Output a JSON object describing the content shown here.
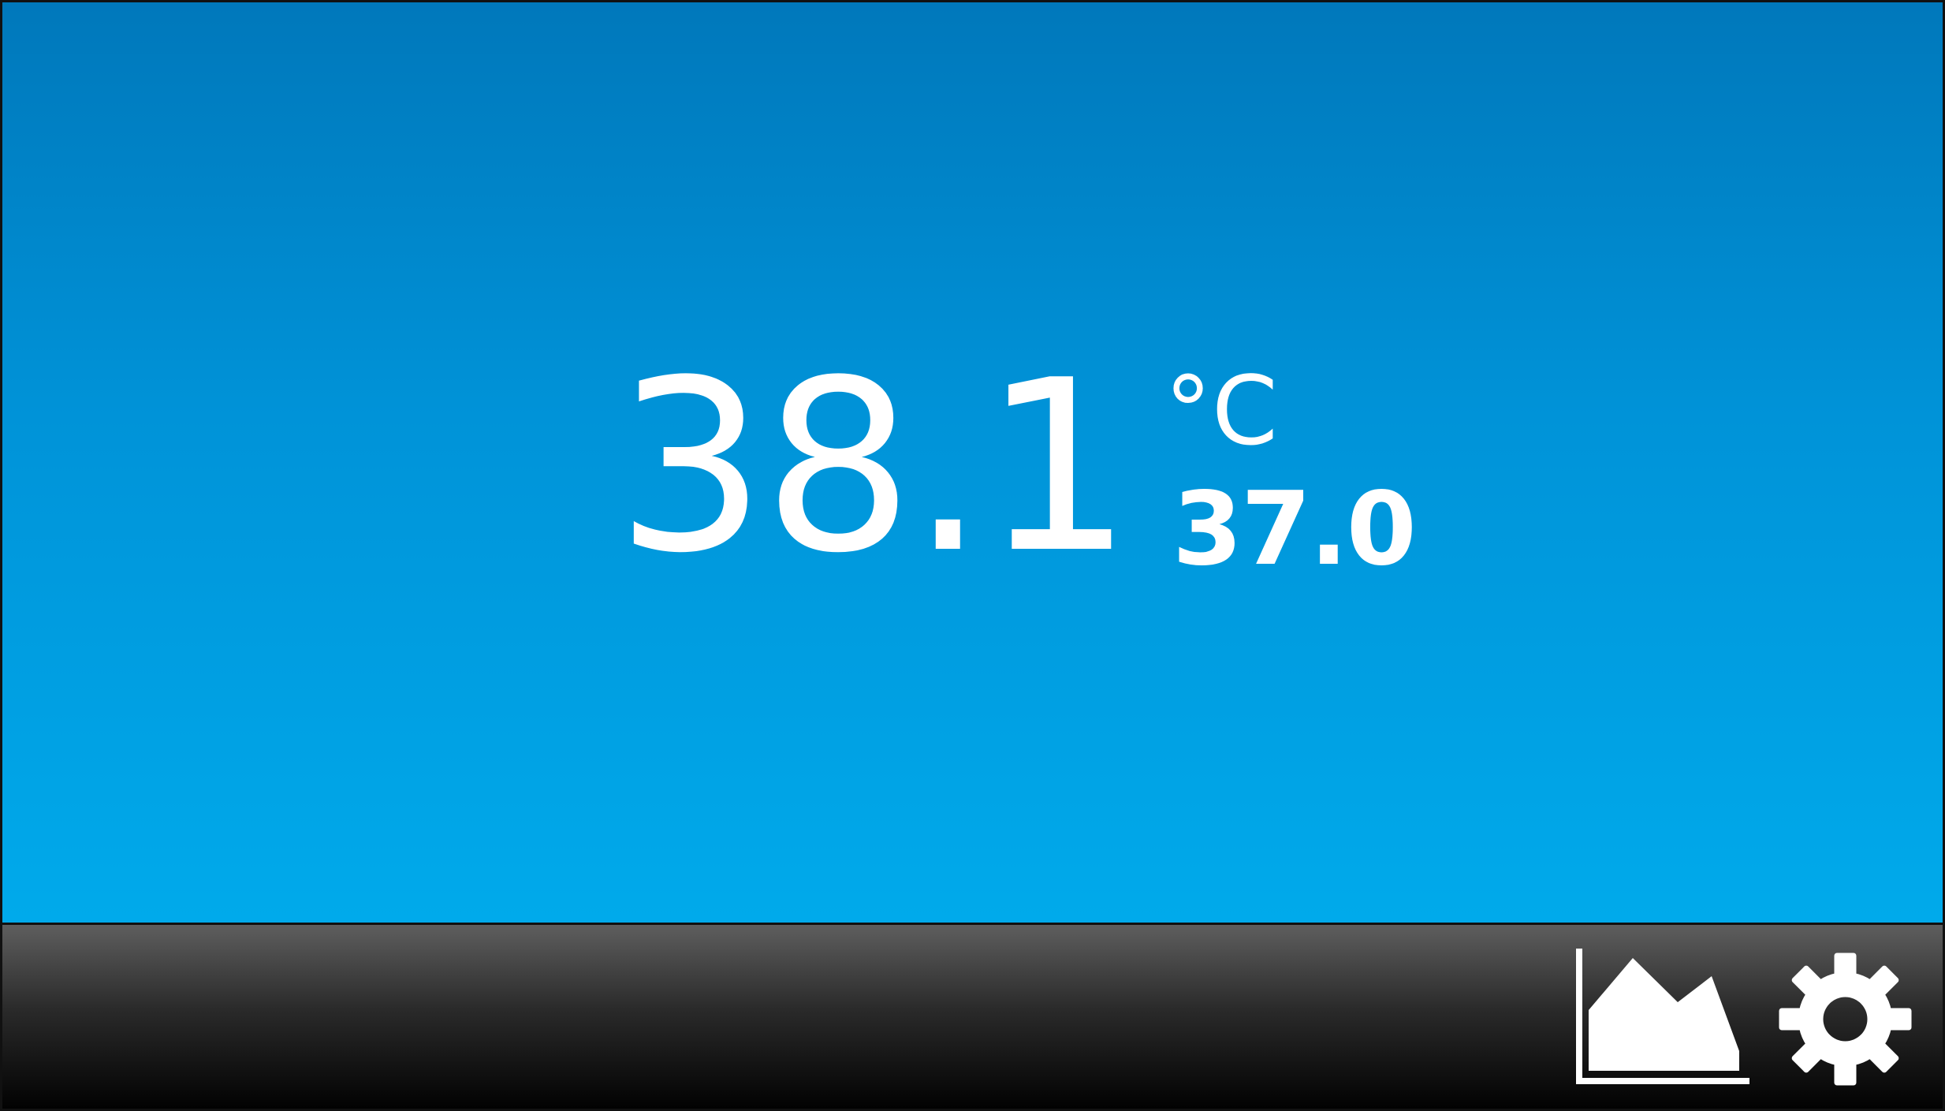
{
  "display": {
    "current_temperature": "38.1",
    "unit": "°C",
    "setpoint": "37.0",
    "background_top": "#0078bb",
    "background_bottom": "#00aaeb",
    "text_color": "#ffffff"
  },
  "toolbar": {
    "buttons": [
      {
        "icon": "area-chart-icon"
      },
      {
        "icon": "gear-icon"
      }
    ]
  }
}
